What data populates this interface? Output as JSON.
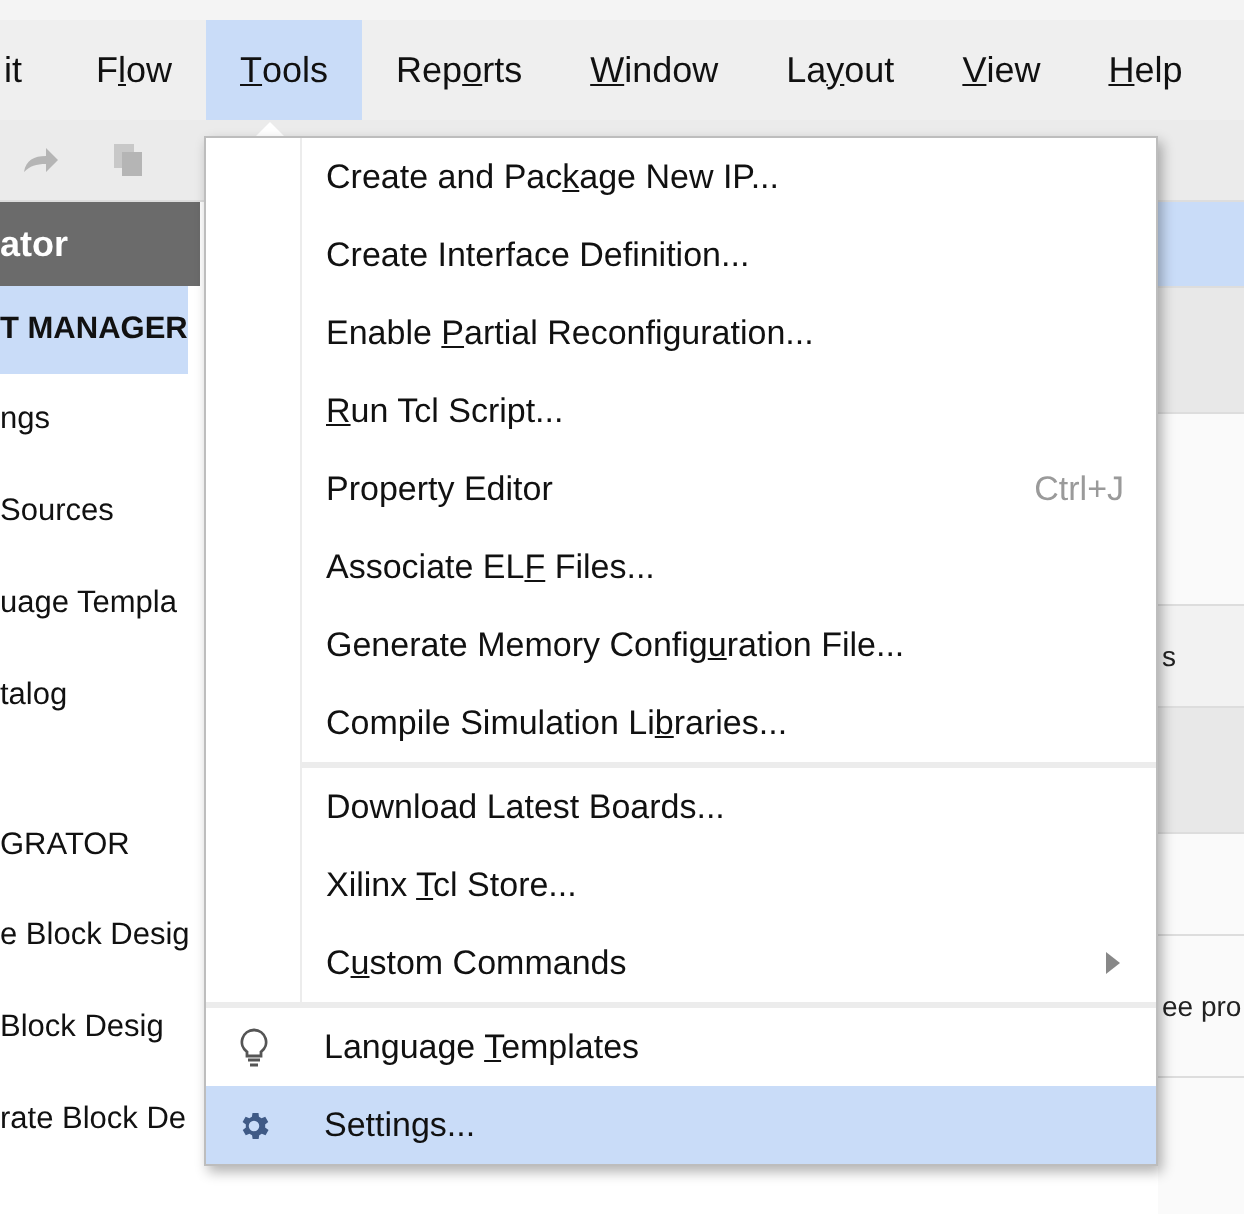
{
  "menu_bar": [
    {
      "before": "it",
      "selected": false
    },
    {
      "before": "F",
      "key": "l",
      "after": "ow",
      "selected": false
    },
    {
      "key": "T",
      "after": "ools",
      "selected": true
    },
    {
      "before": "Rep",
      "key": "o",
      "after": "rts",
      "selected": false
    },
    {
      "key": "W",
      "after": "indow",
      "selected": false
    },
    {
      "before": "La",
      "key": "y",
      "after": "out",
      "selected": false
    },
    {
      "key": "V",
      "after": "iew",
      "selected": false
    },
    {
      "key": "H",
      "after": "elp",
      "selected": false
    }
  ],
  "navigator": {
    "title": "ator",
    "items": [
      {
        "label": "T MANAGER",
        "kind": "section",
        "selected": true
      },
      {
        "label": "ngs",
        "kind": "item",
        "selected": false
      },
      {
        "label": "Sources",
        "kind": "item",
        "selected": false
      },
      {
        "label": "uage Templa",
        "kind": "item",
        "selected": false
      },
      {
        "label": "talog",
        "kind": "item",
        "selected": false
      },
      {
        "label": "GRATOR",
        "kind": "section",
        "selected": false
      },
      {
        "label": "e Block Desig",
        "kind": "item",
        "selected": false
      },
      {
        "label": " Block Desig",
        "kind": "item",
        "selected": false
      },
      {
        "label": "rate Block De",
        "kind": "item",
        "selected": false
      }
    ]
  },
  "right_panel": {
    "texts": [
      "s",
      "ee pro"
    ]
  },
  "tools_menu": {
    "sections": [
      [
        {
          "before": "Create and Pac",
          "key": "k",
          "after": "age New IP...",
          "kind": "command",
          "selected": false
        },
        {
          "before": "Create Interface Definition...",
          "kind": "command",
          "selected": false
        },
        {
          "before": "Enable ",
          "key": "P",
          "after": "artial Reconfiguration...",
          "kind": "command",
          "selected": false
        },
        {
          "key": "R",
          "after": "un Tcl Script...",
          "kind": "command",
          "selected": false
        },
        {
          "before": "Property Editor",
          "kind": "shortcut",
          "shortcut": "Ctrl+J",
          "selected": false
        },
        {
          "before": "Associate EL",
          "key": "F",
          "after": " Files...",
          "kind": "command",
          "selected": false
        },
        {
          "before": "Generate Memory Config",
          "key": "u",
          "after": "ration File...",
          "kind": "command",
          "selected": false
        },
        {
          "before": "Compile Simulation Li",
          "key": "b",
          "after": "raries...",
          "kind": "command",
          "selected": false
        }
      ],
      [
        {
          "before": "Download Latest Boards...",
          "kind": "command",
          "selected": false
        },
        {
          "before": "Xilinx ",
          "key": "T",
          "after": "cl Store...",
          "kind": "command",
          "selected": false
        },
        {
          "before": "C",
          "key": "u",
          "after": "stom Commands",
          "kind": "submenu",
          "selected": false
        }
      ],
      [
        {
          "before": "Language ",
          "key": "T",
          "after": "emplates",
          "kind": "tip",
          "selected": false
        },
        {
          "before": "Settings...",
          "kind": "preferences",
          "selected": true
        }
      ]
    ]
  }
}
